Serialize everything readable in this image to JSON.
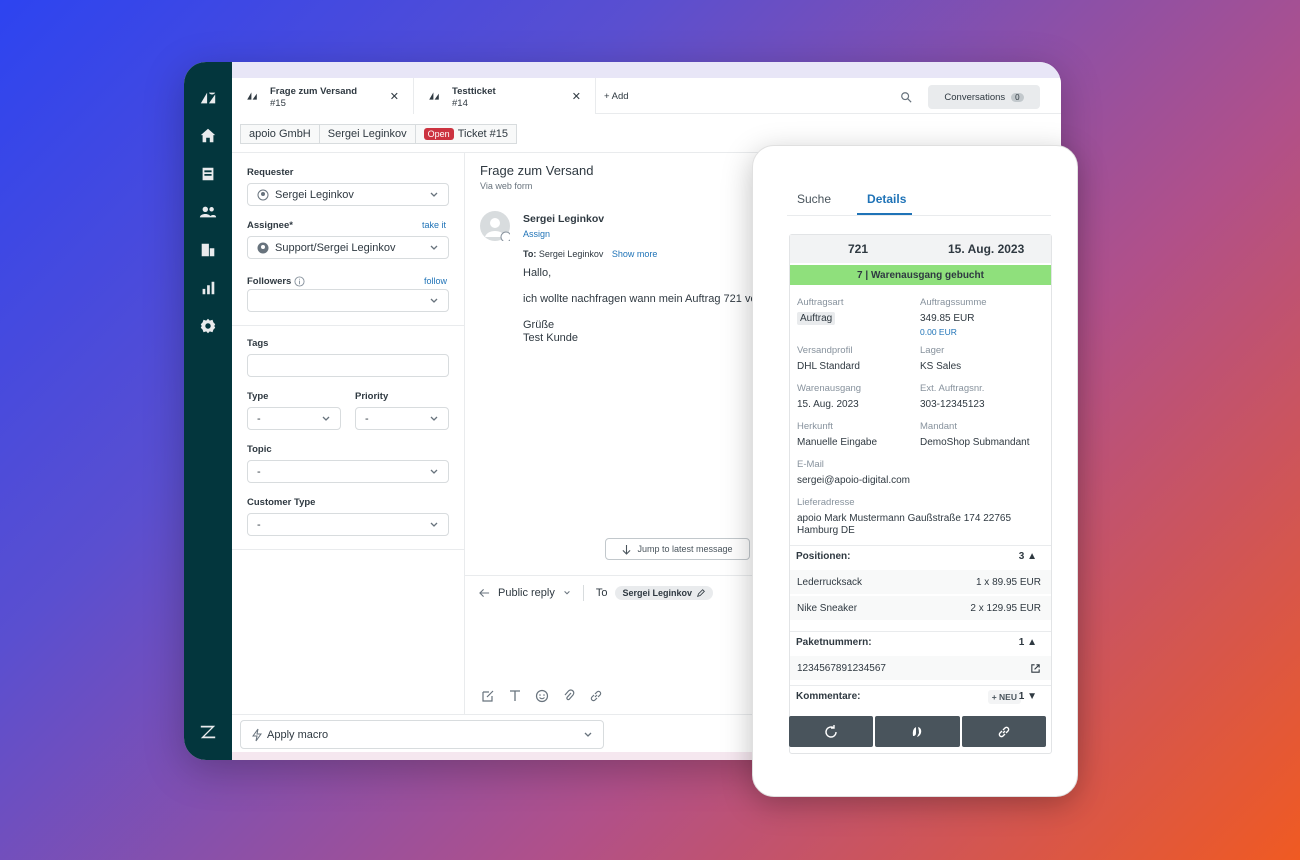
{
  "tabs": [
    {
      "title": "Frage zum Versand",
      "number": "#15"
    },
    {
      "title": "Testticket",
      "number": "#14"
    }
  ],
  "add_tab_label": "+ Add",
  "conversations": {
    "label": "Conversations",
    "count": "0"
  },
  "breadcrumb": {
    "org": "apoio GmbH",
    "user": "Sergei Leginkov",
    "status": "Open",
    "ticket": "Ticket #15"
  },
  "props": {
    "requester_label": "Requester",
    "requester_value": "Sergei Leginkov",
    "assignee_label": "Assignee*",
    "take_it": "take it",
    "assignee_value": "Support/Sergei Leginkov",
    "followers_label": "Followers",
    "follow": "follow",
    "tags_label": "Tags",
    "type_label": "Type",
    "type_value": "-",
    "priority_label": "Priority",
    "priority_value": "-",
    "topic_label": "Topic",
    "topic_value": "-",
    "customer_type_label": "Customer Type",
    "customer_type_value": "-"
  },
  "conversation": {
    "subject": "Frage zum Versand",
    "via": "Via web form",
    "sender": "Sergei Leginkov",
    "assign": "Assign",
    "to_label": "To:",
    "to_value": "Sergei Leginkov",
    "show_more": "Show more",
    "lines": [
      "Hallo,",
      "ich wollte nachfragen wann mein Auftrag 721 ve",
      "Grüße",
      "Test Kunde"
    ],
    "jump": "Jump to latest message",
    "reply_type": "Public reply",
    "reply_to_label": "To",
    "reply_to_value": "Sergei Leginkov"
  },
  "macro": "Apply macro",
  "panel": {
    "tabs": [
      "Suche",
      "Details"
    ],
    "order_id": "721",
    "order_date": "15. Aug. 2023",
    "status": "7 | Warenausgang gebucht",
    "fields": {
      "auftragsart_l": "Auftragsart",
      "auftragsart_v": "Auftrag",
      "summe_l": "Auftragssumme",
      "summe_v": "349.85 EUR",
      "summe_s": "0.00 EUR",
      "versand_l": "Versandprofil",
      "versand_v": "DHL Standard",
      "lager_l": "Lager",
      "lager_v": "KS Sales",
      "wa_l": "Warenausgang",
      "wa_v": "15. Aug. 2023",
      "ext_l": "Ext. Auftragsnr.",
      "ext_v": "303-12345123",
      "herkunft_l": "Herkunft",
      "herkunft_v": "Manuelle Eingabe",
      "mandant_l": "Mandant",
      "mandant_v": "DemoShop Submandant",
      "email_l": "E-Mail",
      "email_v": "sergei@apoio-digital.com",
      "addr_l": "Lieferadresse",
      "addr_v1": "apoio Mark Mustermann Gaußstraße 174 22765",
      "addr_v2": "Hamburg DE"
    },
    "positionen_label": "Positionen:",
    "positionen_count": "3 ▲",
    "items": [
      {
        "name": "Lederrucksack",
        "qty": "1 x 89.95 EUR"
      },
      {
        "name": "Nike Sneaker",
        "qty": "2 x 129.95 EUR"
      }
    ],
    "paket_label": "Paketnummern:",
    "paket_count": "1 ▲",
    "paket_number": "1234567891234567",
    "kommentare_label": "Kommentare:",
    "kommentare_neu": "+ NEU",
    "kommentare_count": "1 ▼"
  }
}
